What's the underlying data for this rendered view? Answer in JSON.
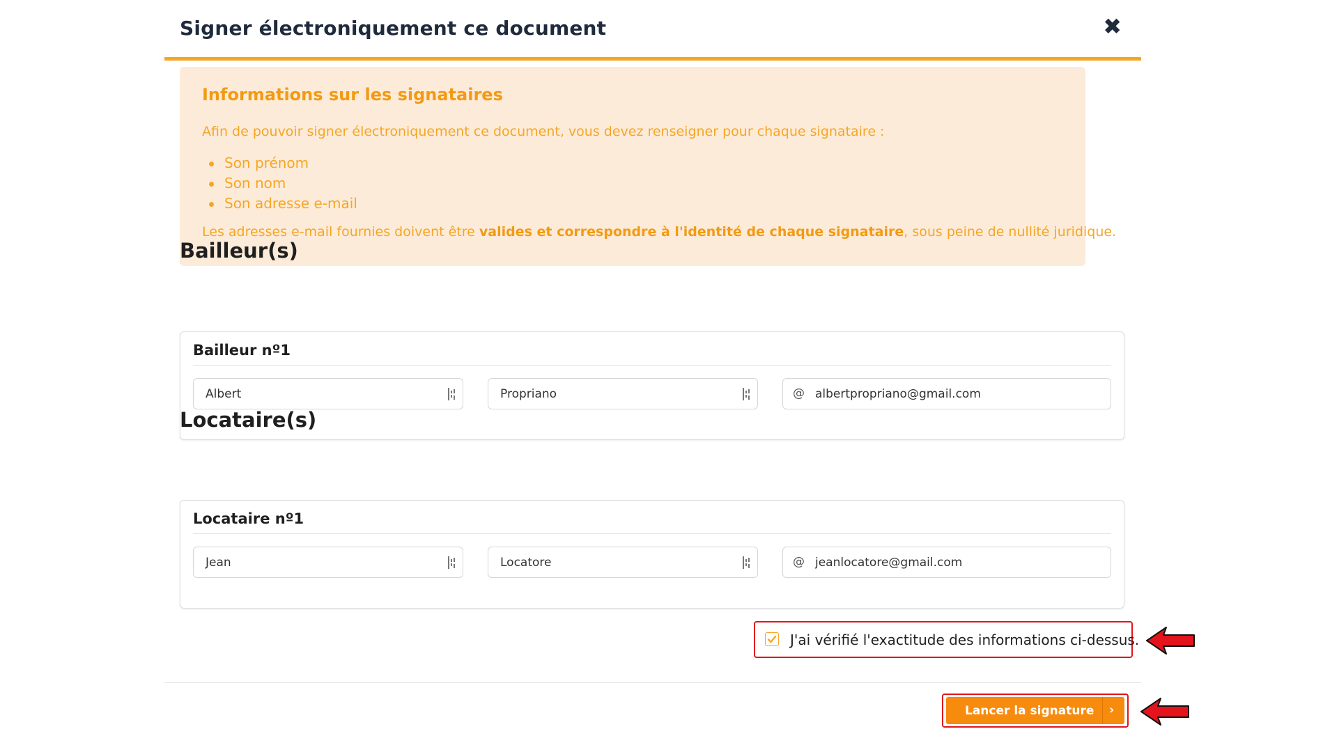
{
  "modal": {
    "title": "Signer électroniquement ce document",
    "close_glyph": "✖"
  },
  "info": {
    "title": "Informations sur les signataires",
    "intro": "Afin de pouvoir signer électroniquement ce document, vous devez renseigner pour chaque signataire :",
    "items": [
      "Son prénom",
      "Son nom",
      "Son adresse e-mail"
    ],
    "legal_prefix": "Les adresses e-mail fournies doivent être ",
    "legal_bold": "valides et correspondre à l'identité de chaque signataire",
    "legal_suffix": ", sous peine de nullité juridique."
  },
  "bailleurs": {
    "section_title": "Bailleur(s)",
    "card_title": "Bailleur nº1",
    "first_name": "Albert",
    "last_name": "Propriano",
    "email_prefix": "@",
    "email": "albertpropriano@gmail.com"
  },
  "locataires": {
    "section_title": "Locataire(s)",
    "card_title": "Locataire nº1",
    "first_name": "Jean",
    "last_name": "Locatore",
    "email_prefix": "@",
    "email": "jeanlocatore@gmail.com"
  },
  "confirm": {
    "checked": true,
    "label": "J'ai vérifié l'exactitude des informations ci-dessus."
  },
  "submit": {
    "label": "Lancer la signature",
    "chevron": "›"
  },
  "colors": {
    "accent": "#f6a623",
    "button": "#f68b0e",
    "highlight": "#e3141c",
    "info_bg": "#fdebd9",
    "title": "#1f2b3d"
  },
  "icons": {
    "close": "close-icon",
    "keyboard": "input-keyboard-icon",
    "at": "at-icon",
    "check": "check-icon",
    "chevron": "chevron-right-icon",
    "annotation": "red-arrow-icon"
  }
}
